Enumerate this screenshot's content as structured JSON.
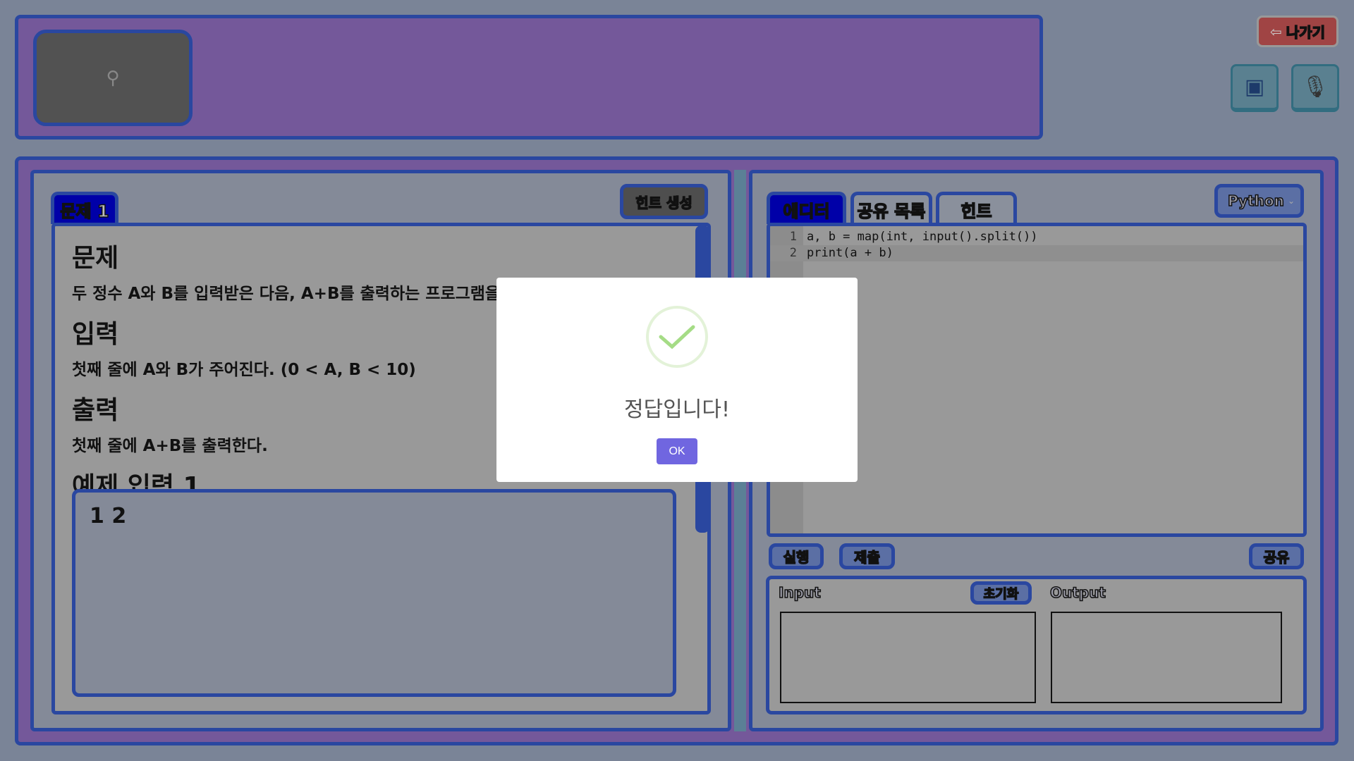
{
  "header": {
    "exit_label": "나가기",
    "video_placeholder_icon": "webcam-icon",
    "camera_icon": "video-camera-icon",
    "mic_icon": "microphone-icon"
  },
  "problem": {
    "tab_label": "문제 1",
    "hint_button": "힌트 생성",
    "sections": [
      {
        "heading": "문제",
        "body": "두 정수 A와 B를 입력받은 다음, A+B를 출력하는 프로그램을 작성하시오."
      },
      {
        "heading": "입력",
        "body": "첫째 줄에 A와 B가 주어진다. (0 < A, B < 10)"
      },
      {
        "heading": "출력",
        "body": "첫째 줄에 A+B를 출력한다."
      }
    ],
    "example_heading": "예제 입력 1",
    "example_input": "1 2"
  },
  "editor": {
    "tabs": [
      "에디터",
      "공유 목록",
      "힌트"
    ],
    "active_tab": "에디터",
    "language": "Python",
    "lines": [
      {
        "num": "1",
        "code": "a, b = map(int, input().split())"
      },
      {
        "num": "2",
        "code": "print(a + b)"
      }
    ],
    "run_button": "실행",
    "submit_button": "제출",
    "share_button": "공유"
  },
  "io": {
    "input_label": "Input",
    "reset_button": "초기화",
    "output_label": "Output",
    "input_value": "",
    "output_value": ""
  },
  "modal": {
    "message": "정답입니다!",
    "ok_label": "OK",
    "icon": "check-icon"
  },
  "colors": {
    "accent": "#7066e0",
    "border": "#2a47a0",
    "panel": "#74589a",
    "success": "#a5dc86"
  }
}
